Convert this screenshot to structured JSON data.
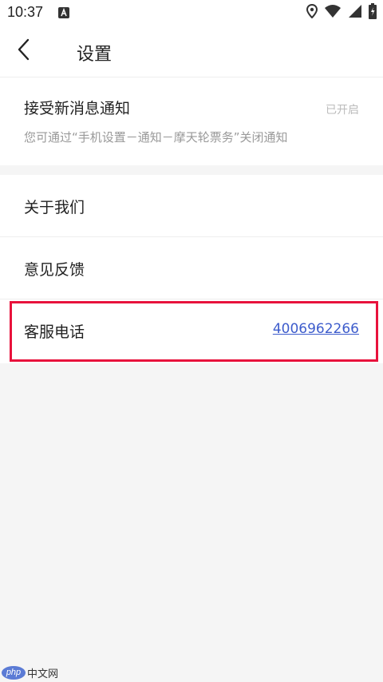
{
  "status_bar": {
    "time": "10:37",
    "icons": [
      "a-notification-icon",
      "location-icon",
      "wifi-icon",
      "signal-icon",
      "battery-charging-icon"
    ]
  },
  "nav": {
    "title": "设置",
    "back_icon": "chevron-left-icon"
  },
  "notifications": {
    "title": "接受新消息通知",
    "status": "已开启",
    "hint": "您可通过“手机设置－通知－摩天轮票务”关闭通知"
  },
  "list": {
    "about": "关于我们",
    "feedback": "意见反馈",
    "service_label": "客服电话",
    "service_phone": "4006962266"
  },
  "watermark": {
    "badge": "php",
    "text": "中文网"
  },
  "colors": {
    "link": "#3d5ccc",
    "highlight": "#e8123c",
    "background": "#f5f5f5"
  }
}
